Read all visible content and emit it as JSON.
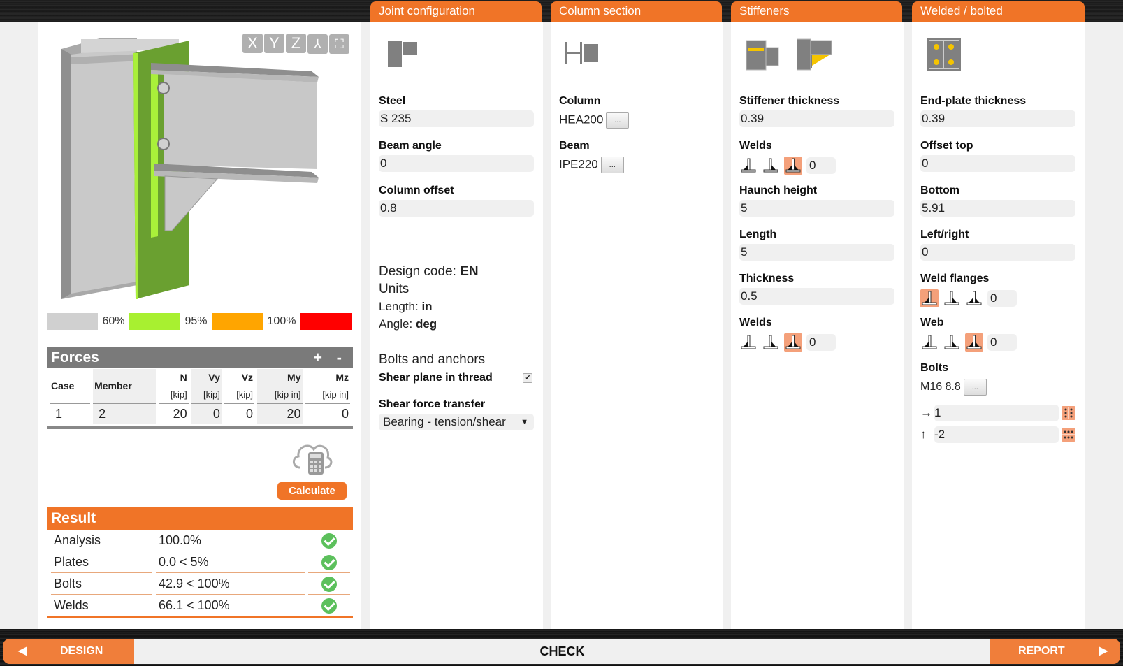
{
  "viewer": {
    "view_buttons": [
      "X",
      "Y",
      "Z",
      "⅄",
      "⛶"
    ],
    "legend": [
      {
        "label": "60%",
        "color": "#d0d0d0"
      },
      {
        "label": "95%",
        "color": "#a8f030"
      },
      {
        "label": "100%",
        "color": "#ffa500"
      },
      {
        "label": "",
        "color": "#ff0000"
      }
    ]
  },
  "forces": {
    "title": "Forces",
    "add_label": "+",
    "remove_label": "-",
    "columns": [
      {
        "name": "Case",
        "unit": ""
      },
      {
        "name": "Member",
        "unit": ""
      },
      {
        "name": "N",
        "unit": "[kip]"
      },
      {
        "name": "Vy",
        "unit": "[kip]"
      },
      {
        "name": "Vz",
        "unit": "[kip]"
      },
      {
        "name": "My",
        "unit": "[kip in]"
      },
      {
        "name": "Mz",
        "unit": "[kip in]"
      }
    ],
    "rows": [
      [
        "1",
        "2",
        "20",
        "0",
        "0",
        "20",
        "0"
      ]
    ]
  },
  "calculate_label": "Calculate",
  "result": {
    "title": "Result",
    "rows": [
      {
        "name": "Analysis",
        "value": "100.0%",
        "status": "ok"
      },
      {
        "name": "Plates",
        "value": "0.0 < 5%",
        "status": "ok"
      },
      {
        "name": "Bolts",
        "value": "42.9 < 100%",
        "status": "ok"
      },
      {
        "name": "Welds",
        "value": "66.1 < 100%",
        "status": "ok"
      }
    ]
  },
  "joint": {
    "title": "Joint configuration",
    "steel_label": "Steel",
    "steel": "S 235",
    "beam_angle_label": "Beam angle",
    "beam_angle": "0",
    "column_offset_label": "Column offset",
    "column_offset": "0.8",
    "design_code_label": "Design code: ",
    "design_code": "EN",
    "units_label": "Units",
    "length_label": "Length: ",
    "length_unit": "in",
    "angle_label": "Angle: ",
    "angle_unit": "deg",
    "bolts_anchors_label": "Bolts and anchors",
    "shear_plane_label": "Shear plane in thread",
    "shear_plane_checked": true,
    "shear_transfer_label": "Shear force transfer",
    "shear_transfer": "Bearing - tension/shear"
  },
  "column_section": {
    "title": "Column section",
    "column_label": "Column",
    "column": "HEA200",
    "beam_label": "Beam",
    "beam": "IPE220",
    "browse_label": "..."
  },
  "stiffeners": {
    "title": "Stiffeners",
    "stiffener_thickness_label": "Stiffener thickness",
    "stiffener_thickness": "0.39",
    "welds_label": "Welds",
    "welds_value": "0",
    "haunch_height_label": "Haunch height",
    "haunch_height": "5",
    "length_label": "Length",
    "length": "5",
    "thickness_label": "Thickness",
    "thickness": "0.5",
    "welds2_label": "Welds",
    "welds2_value": "0"
  },
  "welded_bolted": {
    "title": "Welded / bolted",
    "endplate_thickness_label": "End-plate thickness",
    "endplate_thickness": "0.39",
    "offset_top_label": "Offset top",
    "offset_top": "0",
    "bottom_label": "Bottom",
    "bottom": "5.91",
    "left_right_label": "Left/right",
    "left_right": "0",
    "weld_flanges_label": "Weld flanges",
    "weld_flanges_value": "0",
    "web_label": "Web",
    "web_value": "0",
    "bolts_label": "Bolts",
    "bolts": "M16 8.8",
    "horiz_arrow": "→",
    "horiz_value": "1",
    "vert_arrow": "↑",
    "vert_value": "-2"
  },
  "footer": {
    "design_label": "DESIGN",
    "check_label": "CHECK",
    "report_label": "REPORT"
  },
  "colors": {
    "accent": "#f07427",
    "ok": "#5cc05c",
    "weld_selected": "#f4a07a"
  }
}
